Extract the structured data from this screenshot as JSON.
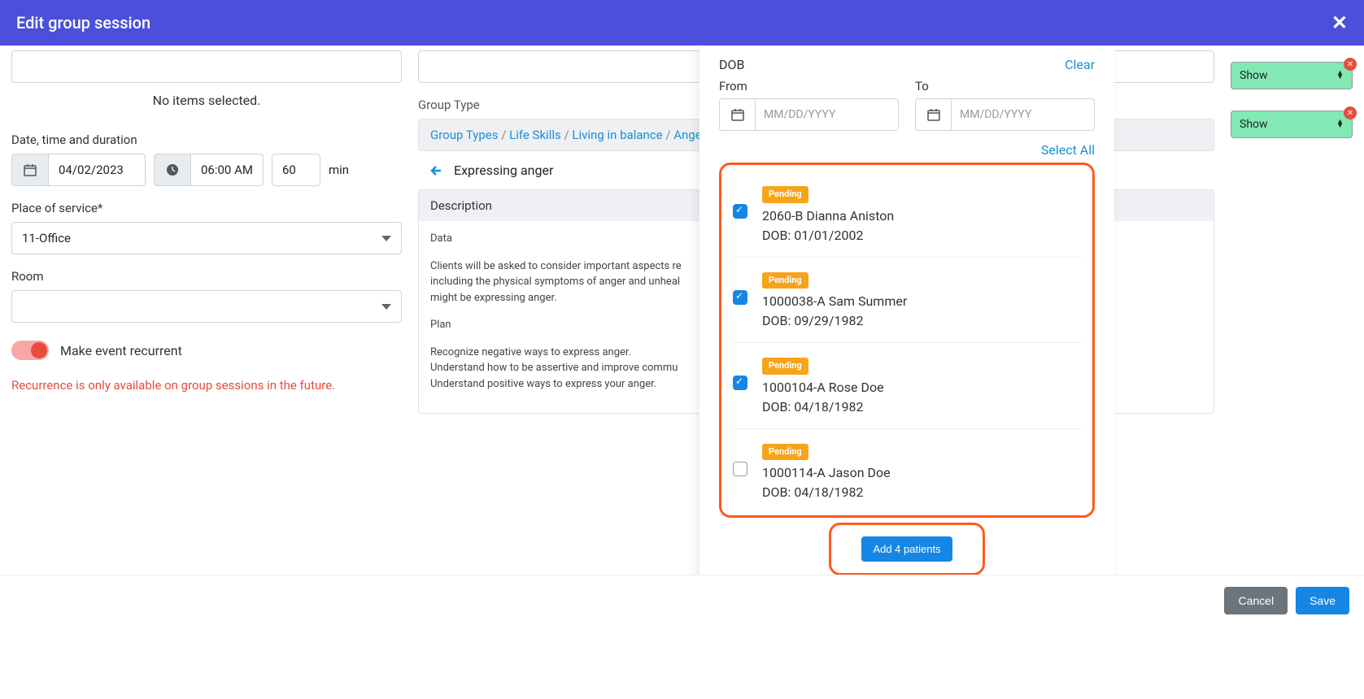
{
  "header": {
    "title": "Edit group session"
  },
  "left": {
    "no_items": "No items selected.",
    "date_label": "Date, time and duration",
    "date": "04/02/2023",
    "time": "06:00 AM",
    "duration": "60",
    "duration_unit": "min",
    "place_label": "Place of service*",
    "place_value": "11-Office",
    "room_label": "Room",
    "room_value": "",
    "recurrent_label": "Make event recurrent",
    "recurrent_warn": "Recurrence is only available on group sessions in the future."
  },
  "mid": {
    "group_type_label": "Group Type",
    "breadcrumb": [
      "Group Types",
      "Life Skills",
      "Living in balance",
      "Anger and communication",
      "Expressing anger"
    ],
    "title": "Expressing anger",
    "desc_header": "Description",
    "desc_data_label": "Data",
    "desc_data": "Clients will be asked to consider important aspects re\nincluding the physical symptoms of anger and unheal\nmight be expressing anger.",
    "desc_plan_label": "Plan",
    "desc_plan": "Recognize negative ways to express anger.\nUnderstand how to be assertive and improve commu\nUnderstand positive ways to express your anger."
  },
  "right_bg": {
    "chip1": "Show",
    "chip2": "Show"
  },
  "panel": {
    "dob_label": "DOB",
    "clear": "Clear",
    "from_label": "From",
    "to_label": "To",
    "date_placeholder": "MM/DD/YYYY",
    "select_all": "Select All",
    "patients": [
      {
        "badge": "Pending",
        "name": "2060-B Dianna Aniston",
        "dob": "DOB: 01/01/2002",
        "checked": true
      },
      {
        "badge": "Pending",
        "name": "1000038-A Sam Summer",
        "dob": "DOB: 09/29/1982",
        "checked": true
      },
      {
        "badge": "Pending",
        "name": "1000104-A Rose Doe",
        "dob": "DOB: 04/18/1982",
        "checked": true
      },
      {
        "badge": "Pending",
        "name": "1000114-A Jason Doe",
        "dob": "DOB: 04/18/1982",
        "checked": false
      }
    ],
    "add_btn": "Add 4 patients"
  },
  "footer": {
    "cancel": "Cancel",
    "save": "Save"
  }
}
